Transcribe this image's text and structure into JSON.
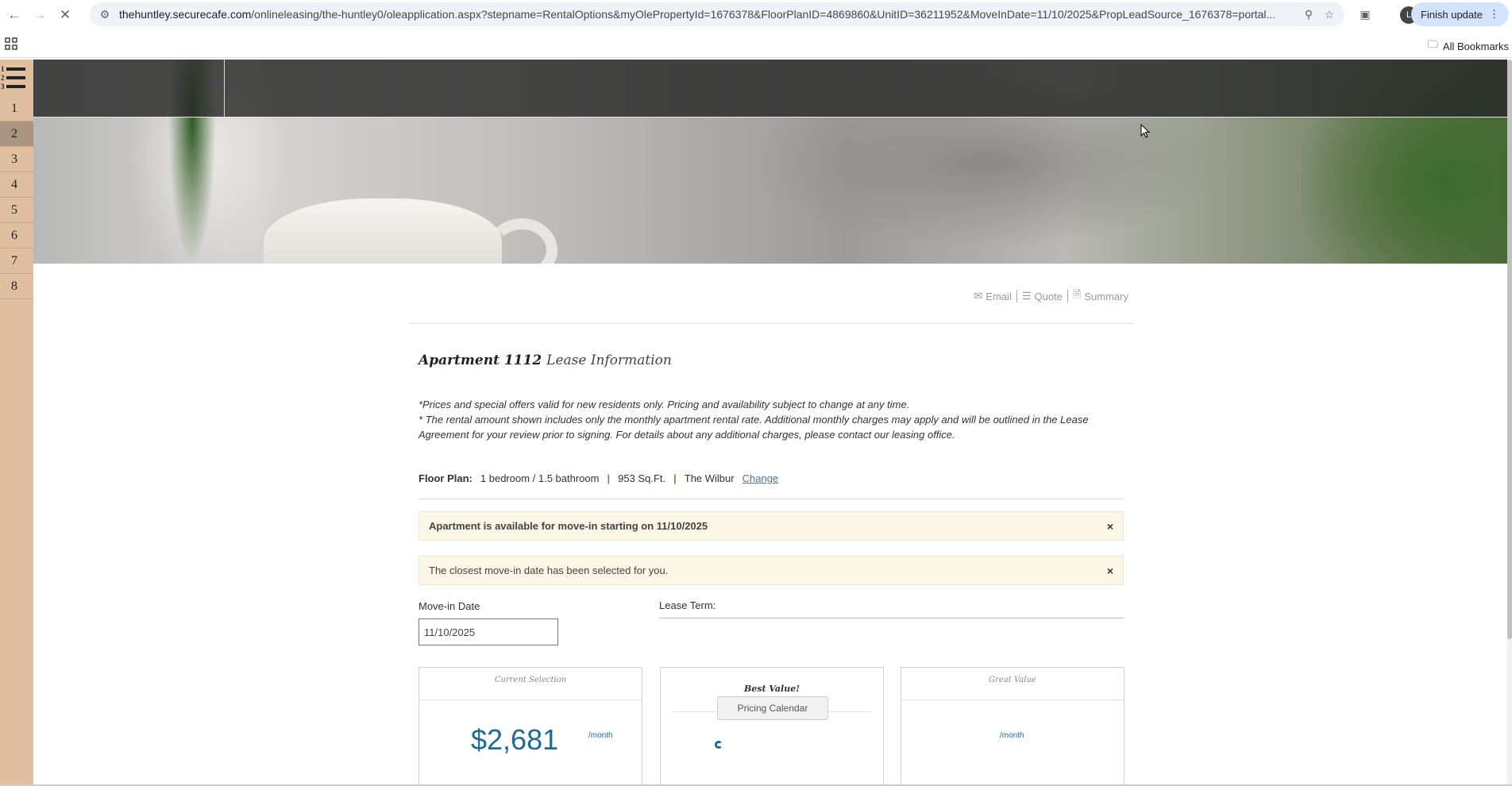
{
  "browser": {
    "url_host": "thehuntley.securecafe.com",
    "url_rest": "/onlineleasing/the-huntley0/oleapplication.aspx?stepname=RentalOptions&myOlePropertyId=1676378&FloorPlanID=4869860&UnitID=36211952&MoveInDate=11/10/2025&PropLeadSource_1676378=portal...",
    "profile_initial": "L",
    "finish_update_label": "Finish update",
    "all_bookmarks_label": "All Bookmarks"
  },
  "steps": [
    "1",
    "2",
    "3",
    "4",
    "5",
    "6",
    "7",
    "8"
  ],
  "active_step": "2",
  "actions": {
    "email": "Email",
    "quote": "Quote",
    "summary": "Summary"
  },
  "title": {
    "apartment": "Apartment 1112",
    "suffix": "Lease Information"
  },
  "disclaimer": {
    "line1": "*Prices and special offers valid for new residents only. Pricing and availability subject to change at any time.",
    "line2": "* The rental amount shown includes only the monthly apartment rental rate. Additional monthly charges may apply and will be outlined in the Lease Agreement for your review prior to signing. For details about any additional charges, please contact our leasing office."
  },
  "floor_plan": {
    "label": "Floor Plan:",
    "beds_baths": "1 bedroom / 1.5 bathroom",
    "sqft": "953 Sq.Ft.",
    "name": "The Wilbur",
    "change": "Change",
    "separator": "|"
  },
  "alerts": [
    {
      "text": "Apartment is available for move-in starting on 11/10/2025",
      "close": "×"
    },
    {
      "text": "The closest move-in date has been selected for you.",
      "close": "×"
    }
  ],
  "move_in": {
    "label": "Move-in Date",
    "value": "11/10/2025"
  },
  "lease_term": {
    "label": "Lease Term:"
  },
  "cards": [
    {
      "heading": "Current Selection",
      "price": "$2,681",
      "per": "/month"
    },
    {
      "heading": "Best Value!",
      "price": "",
      "per": ""
    },
    {
      "heading": "Great Value",
      "price": "",
      "per": "/month"
    }
  ],
  "pricing_calendar": "Pricing Calendar",
  "colors": {
    "stepbar": "#dfbf9f",
    "accent_blue": "#1e6a94",
    "alert_bg": "#fbf6e6"
  }
}
